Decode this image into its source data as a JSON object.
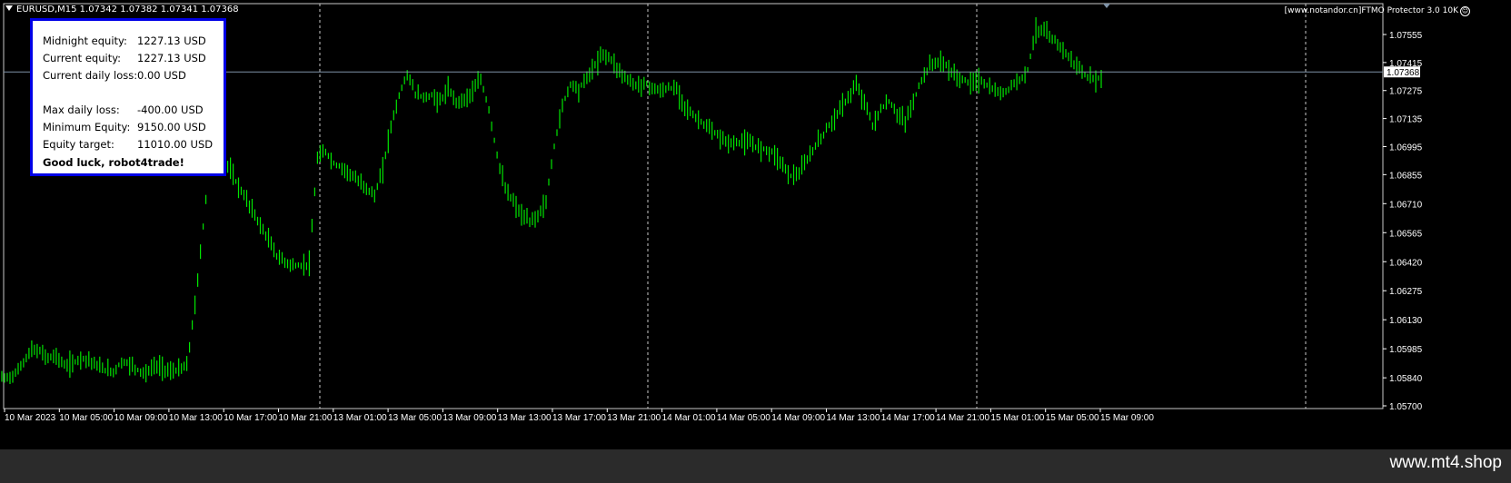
{
  "chart": {
    "symbol_header": "EURUSD,M15  1.07342 1.07382 1.07341 1.07368",
    "ea_label": "[www.notandor.cn]FTMO Protector 3.0 10K",
    "current_price": "1.07368",
    "colors": {
      "background": "#000000",
      "candles": "#00e600",
      "axis": "#ffffff",
      "price_line": "#7f93a8",
      "panel_border": "#0000e6"
    }
  },
  "panel": {
    "midnight_equity_label": "Midnight equity:",
    "midnight_equity_value": "1227.13 USD",
    "current_equity_label": "Current equity:",
    "current_equity_value": "1227.13 USD",
    "daily_loss_label": "Current daily loss:",
    "daily_loss_value": "0.00 USD",
    "max_daily_loss_label": "Max daily loss:",
    "max_daily_loss_value": "-400.00 USD",
    "min_equity_label": "Minimum Equity:",
    "min_equity_value": "9150.00 USD",
    "equity_target_label": "Equity target:",
    "equity_target_value": "11010.00 USD",
    "greeting": "Good luck, robot4trade!"
  },
  "footer": {
    "watermark": "www.mt4.shop"
  },
  "chart_data": {
    "type": "line",
    "title": "EURUSD,M15",
    "series": [
      {
        "name": "EURUSD",
        "values": [
          1.0584,
          1.0586,
          1.0592,
          1.0598,
          1.0597,
          1.0594,
          1.0595,
          1.059,
          1.0591,
          1.0594,
          1.0593,
          1.059,
          1.0588,
          1.0587,
          1.0592,
          1.0591,
          1.0588,
          1.0586,
          1.059,
          1.0589,
          1.0587,
          1.0588,
          1.059,
          1.062,
          1.066,
          1.07,
          1.0712,
          1.069,
          1.0682,
          1.0675,
          1.0668,
          1.066,
          1.0653,
          1.0645,
          1.0642,
          1.064,
          1.064,
          1.0641,
          1.0694,
          1.0697,
          1.0691,
          1.0689,
          1.0686,
          1.0682,
          1.0679,
          1.0675,
          1.0688,
          1.071,
          1.0725,
          1.0736,
          1.0726,
          1.0724,
          1.0725,
          1.0722,
          1.0728,
          1.0722,
          1.0723,
          1.0727,
          1.0733,
          1.0718,
          1.0695,
          1.0678,
          1.0672,
          1.0665,
          1.0662,
          1.0665,
          1.0672,
          1.07,
          1.072,
          1.0731,
          1.0728,
          1.0734,
          1.074,
          1.0746,
          1.0743,
          1.0737,
          1.0733,
          1.073,
          1.0731,
          1.0729,
          1.0727,
          1.0729,
          1.0728,
          1.072,
          1.0715,
          1.0712,
          1.0708,
          1.0705,
          1.0702,
          1.0701,
          1.0702,
          1.0701,
          1.0699,
          1.0698,
          1.0696,
          1.069,
          1.0685,
          1.0686,
          1.0693,
          1.07,
          1.0706,
          1.0712,
          1.0718,
          1.0724,
          1.073,
          1.0722,
          1.071,
          1.0718,
          1.0722,
          1.0716,
          1.0712,
          1.0722,
          1.0733,
          1.074,
          1.0742,
          1.074,
          1.0735,
          1.0733,
          1.0731,
          1.0733,
          1.073,
          1.0727,
          1.0726,
          1.073,
          1.0733,
          1.0738,
          1.0758,
          1.0757,
          1.0753,
          1.075,
          1.0744,
          1.074,
          1.0735,
          1.0733,
          1.0734
        ]
      }
    ],
    "x_tick_labels": [
      "10 Mar 2023",
      "10 Mar 05:00",
      "10 Mar 09:00",
      "10 Mar 13:00",
      "10 Mar 17:00",
      "10 Mar 21:00",
      "13 Mar 01:00",
      "13 Mar 05:00",
      "13 Mar 09:00",
      "13 Mar 13:00",
      "13 Mar 17:00",
      "13 Mar 21:00",
      "14 Mar 01:00",
      "14 Mar 05:00",
      "14 Mar 09:00",
      "14 Mar 13:00",
      "14 Mar 17:00",
      "14 Mar 21:00",
      "15 Mar 01:00",
      "15 Mar 05:00",
      "15 Mar 09:00"
    ],
    "y_tick_labels": [
      "1.07555",
      "1.07415",
      "1.07275",
      "1.07135",
      "1.06995",
      "1.06855",
      "1.06710",
      "1.06565",
      "1.06420",
      "1.06275",
      "1.06130",
      "1.05985",
      "1.05840",
      "1.05700"
    ],
    "ylim": [
      1.057,
      1.076
    ],
    "current_price": 1.07368
  }
}
